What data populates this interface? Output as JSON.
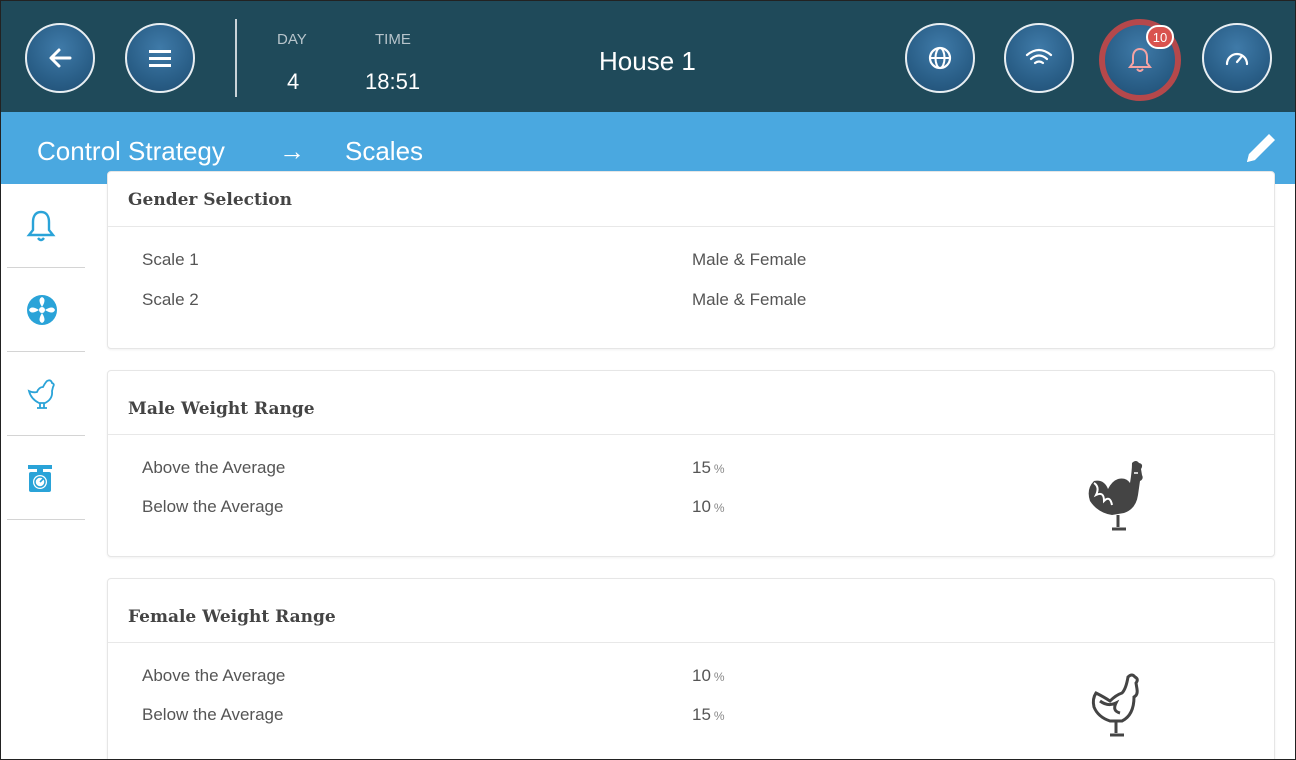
{
  "header": {
    "day_label": "DAY",
    "day_value": "4",
    "time_label": "TIME",
    "time_value": "18:51",
    "house": "House 1",
    "alarm_count": "10"
  },
  "breadcrumb": {
    "parent": "Control Strategy",
    "separator": "→",
    "current": "Scales"
  },
  "sidenav": {
    "items": [
      {
        "icon": "bell-icon"
      },
      {
        "icon": "fan-icon"
      },
      {
        "icon": "rooster-icon"
      },
      {
        "icon": "scale-icon"
      }
    ]
  },
  "gender_selection": {
    "title": "Gender Selection",
    "rows": [
      {
        "label": "Scale 1",
        "value": "Male & Female"
      },
      {
        "label": "Scale 2",
        "value": "Male & Female"
      }
    ]
  },
  "male_range": {
    "title": "Male Weight Range",
    "rows": [
      {
        "label": "Above the Average",
        "value": "15",
        "unit": "%"
      },
      {
        "label": "Below the Average",
        "value": "10",
        "unit": "%"
      }
    ]
  },
  "female_range": {
    "title": "Female Weight Range",
    "rows": [
      {
        "label": "Above the Average",
        "value": "10",
        "unit": "%"
      },
      {
        "label": "Below the Average",
        "value": "15",
        "unit": "%"
      }
    ]
  },
  "colors": {
    "topbar": "#1f4a5a",
    "subbar": "#4aa8e0",
    "button": "#2a5f88",
    "alarm_ring": "#b5484b",
    "badge": "#d9534f",
    "nav_icon": "#2aa3d8"
  }
}
